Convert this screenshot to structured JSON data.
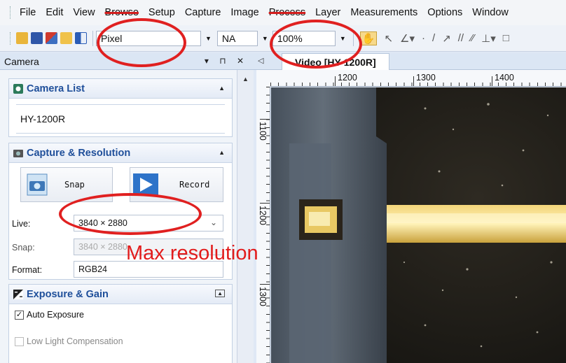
{
  "menu": {
    "items": [
      "File",
      "Edit",
      "View",
      "Browse",
      "Setup",
      "Capture",
      "Image",
      "Process",
      "Layer",
      "Measurements",
      "Options",
      "Window"
    ]
  },
  "toolbar": {
    "unit_value": "Pixel",
    "ratio_value": "NA",
    "zoom_value": "100%"
  },
  "left_panel": {
    "title": "Camera",
    "camera_list": {
      "header": "Camera List",
      "item": "HY-1200R"
    },
    "capture": {
      "header": "Capture & Resolution",
      "snap_label": "Snap",
      "record_label": "Record",
      "live_label": "Live:",
      "live_value": "3840 × 2880",
      "snap_res_label": "Snap:",
      "snap_res_value": "3840 × 2880",
      "format_label": "Format:",
      "format_value": "RGB24"
    },
    "exposure": {
      "header": "Exposure & Gain",
      "auto_exposure_label": "Auto Exposure",
      "auto_exposure_checked": true,
      "low_light_label": "Low Light Compensation",
      "low_light_checked": false
    }
  },
  "video": {
    "tab_label": "Video [HY-1200R]",
    "ruler_x_labels": [
      "1200",
      "1300",
      "1400"
    ],
    "ruler_y_labels": [
      "1100",
      "1200",
      "1300"
    ]
  },
  "annotation": {
    "text": "Max resolution",
    "color": "#e21c1c"
  },
  "colors": {
    "accent": "#1f4f9a",
    "panel_bg": "#f0f4f9",
    "annotation_red": "#e02020"
  }
}
